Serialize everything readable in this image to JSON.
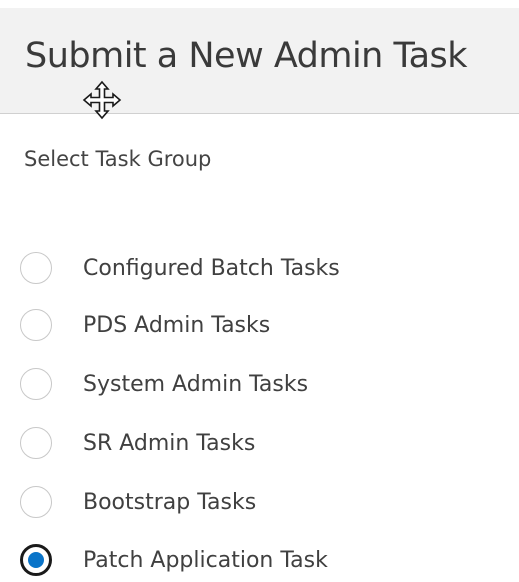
{
  "dialog": {
    "title": "Submit a New Admin Task"
  },
  "task_group": {
    "label": "Select Task Group",
    "selected": "Patch Application Task",
    "options": [
      {
        "label": "Configured Batch Tasks",
        "checked": false
      },
      {
        "label": "PDS Admin Tasks",
        "checked": false
      },
      {
        "label": "System Admin Tasks",
        "checked": false
      },
      {
        "label": "SR Admin Tasks",
        "checked": false
      },
      {
        "label": "Bootstrap Tasks",
        "checked": false
      },
      {
        "label": "Patch Application Task",
        "checked": true
      }
    ]
  },
  "colors": {
    "header_bg": "#f2f2f2",
    "radio_selected": "#0a74c9",
    "text": "#404040"
  },
  "icons": {
    "cursor": "move-cursor-icon"
  }
}
